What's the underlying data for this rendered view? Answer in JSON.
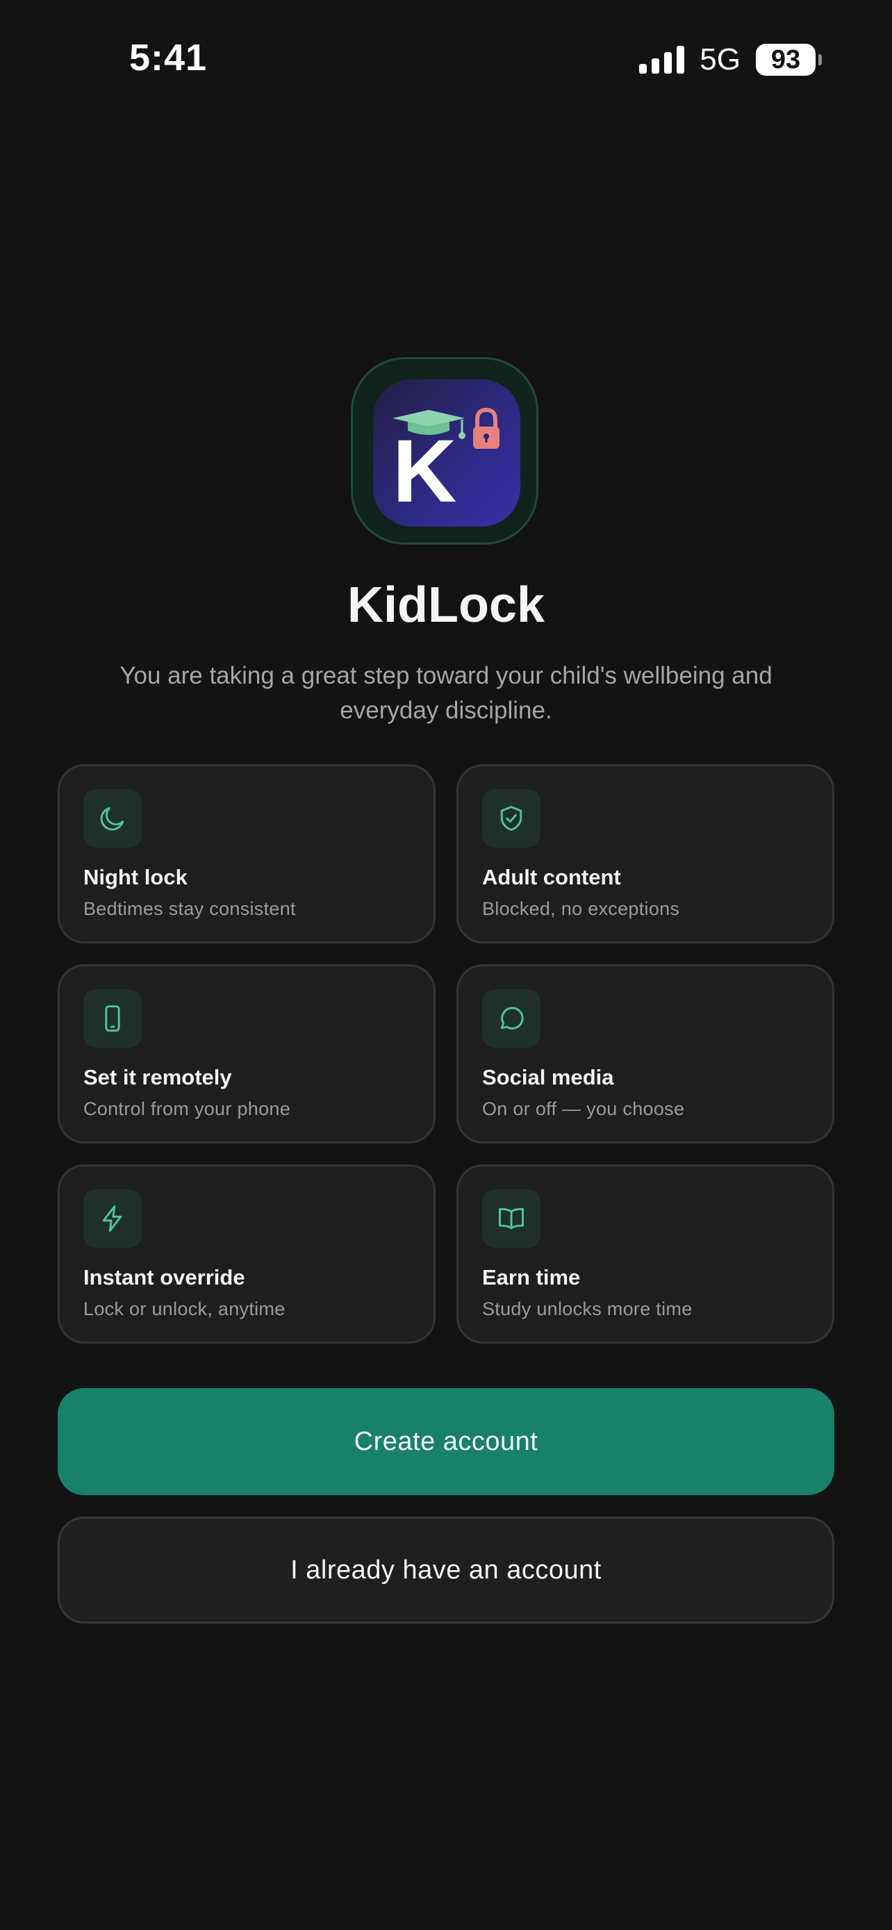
{
  "status_bar": {
    "time": "5:41",
    "network": "5G",
    "battery": "93"
  },
  "app": {
    "name": "KidLock",
    "logo_letter": "K",
    "tagline": "You are taking a great step toward your child's wellbeing and everyday discipline."
  },
  "features": [
    {
      "icon": "moon-icon",
      "title": "Night lock",
      "description": "Bedtimes stay consistent"
    },
    {
      "icon": "shield-check-icon",
      "title": "Adult content",
      "description": "Blocked, no exceptions"
    },
    {
      "icon": "phone-icon",
      "title": "Set it remotely",
      "description": "Control from your phone"
    },
    {
      "icon": "chat-bubble-icon",
      "title": "Social media",
      "description": "On or off — you choose"
    },
    {
      "icon": "lightning-icon",
      "title": "Instant override",
      "description": "Lock or unlock, anytime"
    },
    {
      "icon": "book-icon",
      "title": "Earn time",
      "description": "Study unlocks more time"
    }
  ],
  "actions": {
    "create_account": "Create account",
    "sign_in": "I already have an account"
  },
  "colors": {
    "background": "#131313",
    "accent": "#188268",
    "icon_accent": "#4fc39b",
    "lock_icon": "#e8807e"
  }
}
